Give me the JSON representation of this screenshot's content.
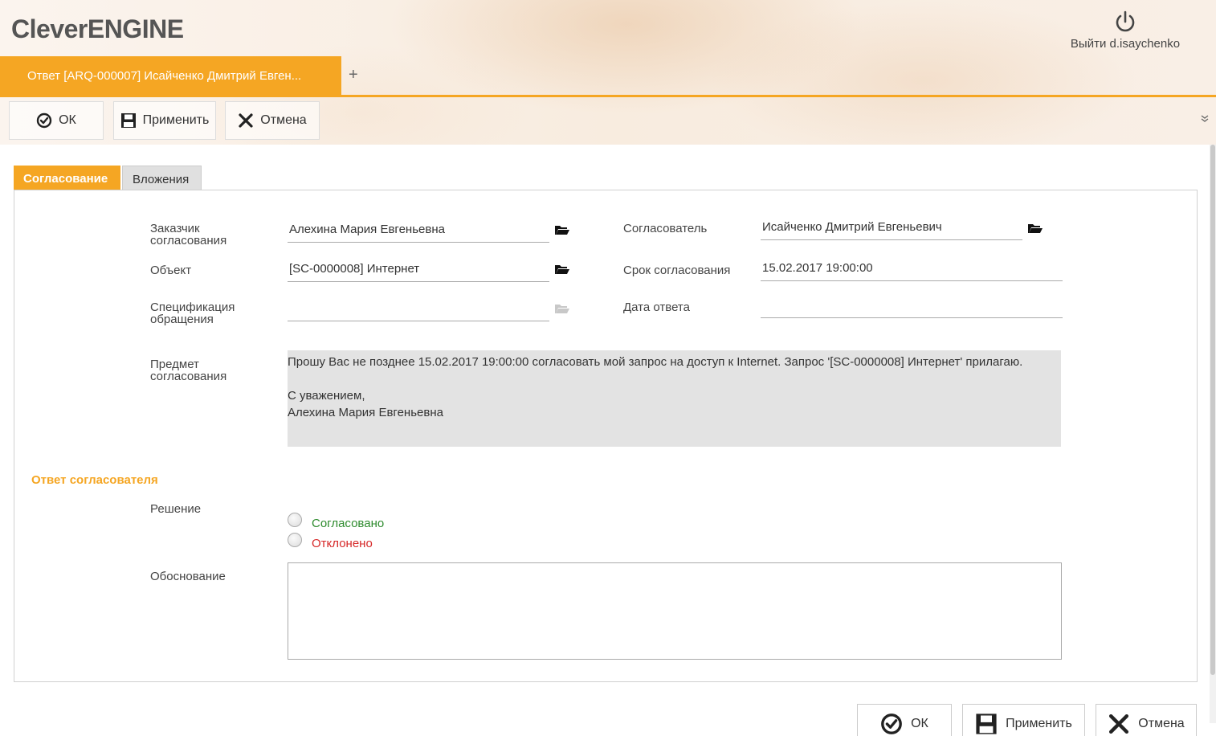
{
  "app": {
    "logo": "CleverENGINE",
    "logout_label": "Выйти d.isaychenko"
  },
  "tabs": {
    "active_label": "Ответ [ARQ-000007] Исайченко Дмитрий Евген...",
    "add_label": "+"
  },
  "toolbar": {
    "ok_label": "ОК",
    "apply_label": "Применить",
    "cancel_label": "Отмена"
  },
  "form_tabs": {
    "approval": "Согласование",
    "attachments": "Вложения"
  },
  "fields": {
    "customer_label": "Заказчик согласования",
    "customer_value": "Алехина Мария Евгеньевна",
    "approver_label": "Согласователь",
    "approver_value": "Исайченко Дмитрий Евгеньевич",
    "object_label": "Объект",
    "object_value": "[SC-0000008] Интернет",
    "deadline_label": "Срок согласования",
    "deadline_value": "15.02.2017 19:00:00",
    "spec_label": "Спецификация обращения",
    "spec_value": "",
    "answer_date_label": "Дата ответа",
    "answer_date_value": "",
    "subject_label": "Предмет согласования",
    "subject_line1": "Прошу Вас не позднее 15.02.2017 19:00:00 согласовать мой запрос на доступ к Internet. Запрос '[SC-0000008] Интернет' прилагаю.",
    "subject_line2": "С уважением,",
    "subject_line3": "Алехина Мария Евгеньевна"
  },
  "response": {
    "section_title": "Ответ согласователя",
    "decision_label": "Решение",
    "option_approved": "Согласовано",
    "option_rejected": "Отклонено",
    "reason_label": "Обоснование",
    "reason_value": ""
  },
  "bottom_toolbar": {
    "ok_label": "ОК",
    "apply_label": "Применить",
    "cancel_label": "Отмена"
  },
  "colors": {
    "accent": "#f5a623",
    "approved": "#2e8b2e",
    "rejected": "#d62828"
  }
}
